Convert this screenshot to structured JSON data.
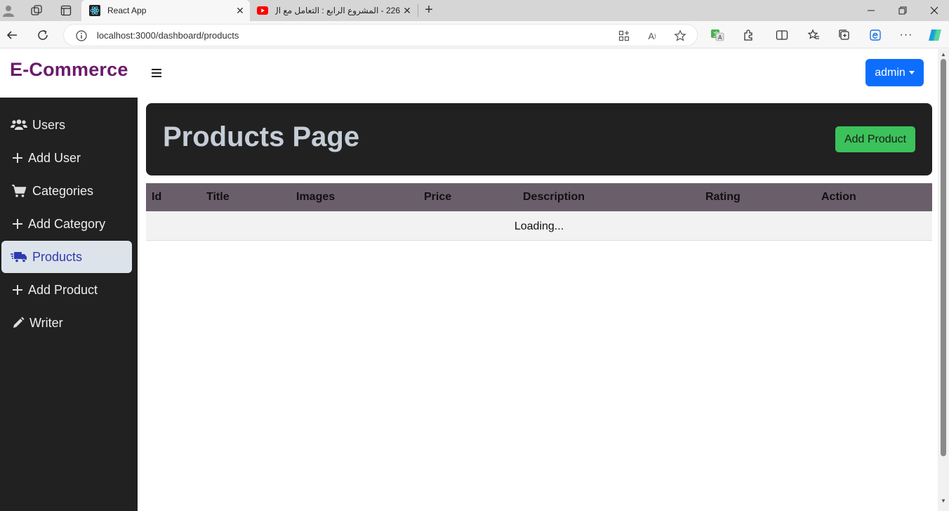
{
  "browser": {
    "tabs": [
      {
        "title": "React App",
        "active": true
      },
      {
        "title": "226 - المشروع الرابع : التعامل مع ال",
        "active": false
      }
    ],
    "url": "localhost:3000/dashboard/products"
  },
  "header": {
    "brand": "E-Commerce",
    "user_menu_label": "admin"
  },
  "sidebar": {
    "items": [
      {
        "label": "Users",
        "icon": "users-icon",
        "active": false
      },
      {
        "label": "Add User",
        "icon": "plus-icon",
        "active": false
      },
      {
        "label": "Categories",
        "icon": "cart-icon",
        "active": false
      },
      {
        "label": "Add Category",
        "icon": "plus-icon",
        "active": false
      },
      {
        "label": "Products",
        "icon": "truck-icon",
        "active": true
      },
      {
        "label": "Add Product",
        "icon": "plus-icon",
        "active": false
      },
      {
        "label": "Writer",
        "icon": "pen-icon",
        "active": false
      }
    ]
  },
  "main": {
    "page_title": "Products Page",
    "add_button_label": "Add Product",
    "table": {
      "columns": [
        "Id",
        "Title",
        "Images",
        "Price",
        "Description",
        "Rating",
        "Action"
      ],
      "status_text": "Loading..."
    }
  },
  "colors": {
    "brand": "#6b1a6b",
    "primary": "#0d6efd",
    "success": "#3cc25a",
    "sidebar_bg": "#212121",
    "table_header": "#6b5e6b"
  }
}
